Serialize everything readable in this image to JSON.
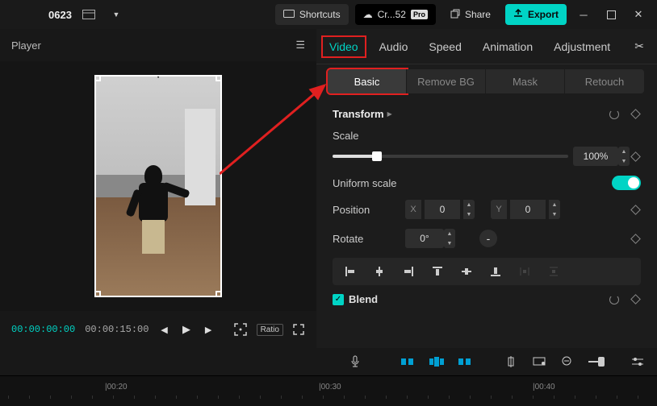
{
  "topbar": {
    "project_name": "0623",
    "shortcuts_label": "Shortcuts",
    "cloud_label": "Cr...52",
    "pro_badge": "Pro",
    "share_label": "Share",
    "export_label": "Export"
  },
  "player": {
    "title": "Player",
    "timecode_current": "00:00:00:00",
    "timecode_duration": "00:00:15:00",
    "ratio_label": "Ratio"
  },
  "inspector": {
    "tabs": [
      "Video",
      "Audio",
      "Speed",
      "Animation",
      "Adjustment"
    ],
    "sub_tabs": [
      "Basic",
      "Remove BG",
      "Mask",
      "Retouch"
    ],
    "transform": {
      "title": "Transform",
      "scale_label": "Scale",
      "scale_value": "100%",
      "uniform_label": "Uniform scale",
      "position_label": "Position",
      "pos_x_label": "X",
      "pos_x_value": "0",
      "pos_y_label": "Y",
      "pos_y_value": "0",
      "rotate_label": "Rotate",
      "rotate_value": "0°",
      "mirror_symbol": "-"
    },
    "blend": {
      "title": "Blend"
    }
  },
  "timeline": {
    "ticks": [
      "|00:20",
      "|00:30",
      "|00:40"
    ]
  }
}
